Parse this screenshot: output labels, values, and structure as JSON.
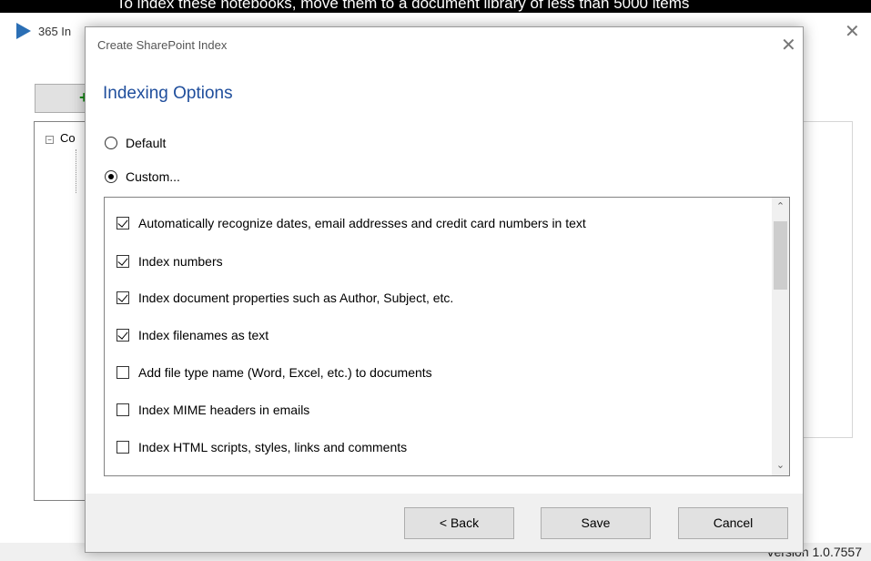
{
  "banner": {
    "text": "To index these notebooks, move them to a document library of less than 5000 items"
  },
  "background_app": {
    "title": "365 In",
    "tree_item_label": "Co",
    "add_button_label": "+",
    "version": "Version 1.0.7557",
    "close_icon": "close-icon"
  },
  "dialog": {
    "title": "Create SharePoint Index",
    "heading": "Indexing Options",
    "radios": [
      {
        "label": "Default",
        "checked": false
      },
      {
        "label": "Custom...",
        "checked": true
      }
    ],
    "options": [
      {
        "label": "Automatically recognize dates, email addresses and credit card numbers in text",
        "checked": true
      },
      {
        "label": "Index numbers",
        "checked": true
      },
      {
        "label": "Index document properties such as Author, Subject, etc.",
        "checked": true
      },
      {
        "label": "Index filenames as text",
        "checked": true
      },
      {
        "label": "Add file type name (Word, Excel, etc.) to documents",
        "checked": false
      },
      {
        "label": "Index MIME headers in emails",
        "checked": false
      },
      {
        "label": "Index HTML scripts, styles, links and comments",
        "checked": false
      }
    ],
    "buttons": {
      "back": "< Back",
      "save": "Save",
      "cancel": "Cancel"
    },
    "colors": {
      "heading": "#1f4e9c",
      "app_logo": "#2b6fb5"
    }
  }
}
